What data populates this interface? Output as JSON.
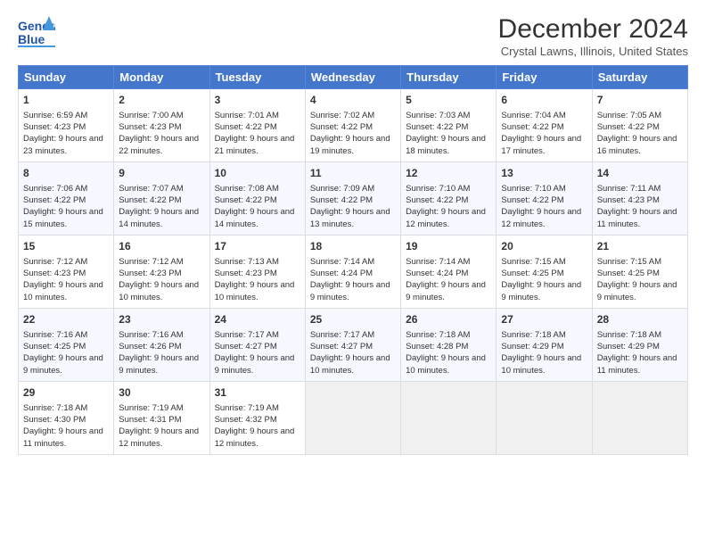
{
  "header": {
    "logo_line1": "General",
    "logo_line2": "Blue",
    "month_title": "December 2024",
    "location": "Crystal Lawns, Illinois, United States"
  },
  "days_of_week": [
    "Sunday",
    "Monday",
    "Tuesday",
    "Wednesday",
    "Thursday",
    "Friday",
    "Saturday"
  ],
  "weeks": [
    [
      {
        "day": "1",
        "sunrise": "6:59 AM",
        "sunset": "4:23 PM",
        "daylight": "9 hours and 23 minutes."
      },
      {
        "day": "2",
        "sunrise": "7:00 AM",
        "sunset": "4:23 PM",
        "daylight": "9 hours and 22 minutes."
      },
      {
        "day": "3",
        "sunrise": "7:01 AM",
        "sunset": "4:22 PM",
        "daylight": "9 hours and 21 minutes."
      },
      {
        "day": "4",
        "sunrise": "7:02 AM",
        "sunset": "4:22 PM",
        "daylight": "9 hours and 19 minutes."
      },
      {
        "day": "5",
        "sunrise": "7:03 AM",
        "sunset": "4:22 PM",
        "daylight": "9 hours and 18 minutes."
      },
      {
        "day": "6",
        "sunrise": "7:04 AM",
        "sunset": "4:22 PM",
        "daylight": "9 hours and 17 minutes."
      },
      {
        "day": "7",
        "sunrise": "7:05 AM",
        "sunset": "4:22 PM",
        "daylight": "9 hours and 16 minutes."
      }
    ],
    [
      {
        "day": "8",
        "sunrise": "7:06 AM",
        "sunset": "4:22 PM",
        "daylight": "9 hours and 15 minutes."
      },
      {
        "day": "9",
        "sunrise": "7:07 AM",
        "sunset": "4:22 PM",
        "daylight": "9 hours and 14 minutes."
      },
      {
        "day": "10",
        "sunrise": "7:08 AM",
        "sunset": "4:22 PM",
        "daylight": "9 hours and 14 minutes."
      },
      {
        "day": "11",
        "sunrise": "7:09 AM",
        "sunset": "4:22 PM",
        "daylight": "9 hours and 13 minutes."
      },
      {
        "day": "12",
        "sunrise": "7:10 AM",
        "sunset": "4:22 PM",
        "daylight": "9 hours and 12 minutes."
      },
      {
        "day": "13",
        "sunrise": "7:10 AM",
        "sunset": "4:22 PM",
        "daylight": "9 hours and 12 minutes."
      },
      {
        "day": "14",
        "sunrise": "7:11 AM",
        "sunset": "4:23 PM",
        "daylight": "9 hours and 11 minutes."
      }
    ],
    [
      {
        "day": "15",
        "sunrise": "7:12 AM",
        "sunset": "4:23 PM",
        "daylight": "9 hours and 10 minutes."
      },
      {
        "day": "16",
        "sunrise": "7:12 AM",
        "sunset": "4:23 PM",
        "daylight": "9 hours and 10 minutes."
      },
      {
        "day": "17",
        "sunrise": "7:13 AM",
        "sunset": "4:23 PM",
        "daylight": "9 hours and 10 minutes."
      },
      {
        "day": "18",
        "sunrise": "7:14 AM",
        "sunset": "4:24 PM",
        "daylight": "9 hours and 9 minutes."
      },
      {
        "day": "19",
        "sunrise": "7:14 AM",
        "sunset": "4:24 PM",
        "daylight": "9 hours and 9 minutes."
      },
      {
        "day": "20",
        "sunrise": "7:15 AM",
        "sunset": "4:25 PM",
        "daylight": "9 hours and 9 minutes."
      },
      {
        "day": "21",
        "sunrise": "7:15 AM",
        "sunset": "4:25 PM",
        "daylight": "9 hours and 9 minutes."
      }
    ],
    [
      {
        "day": "22",
        "sunrise": "7:16 AM",
        "sunset": "4:25 PM",
        "daylight": "9 hours and 9 minutes."
      },
      {
        "day": "23",
        "sunrise": "7:16 AM",
        "sunset": "4:26 PM",
        "daylight": "9 hours and 9 minutes."
      },
      {
        "day": "24",
        "sunrise": "7:17 AM",
        "sunset": "4:27 PM",
        "daylight": "9 hours and 9 minutes."
      },
      {
        "day": "25",
        "sunrise": "7:17 AM",
        "sunset": "4:27 PM",
        "daylight": "9 hours and 10 minutes."
      },
      {
        "day": "26",
        "sunrise": "7:18 AM",
        "sunset": "4:28 PM",
        "daylight": "9 hours and 10 minutes."
      },
      {
        "day": "27",
        "sunrise": "7:18 AM",
        "sunset": "4:29 PM",
        "daylight": "9 hours and 10 minutes."
      },
      {
        "day": "28",
        "sunrise": "7:18 AM",
        "sunset": "4:29 PM",
        "daylight": "9 hours and 11 minutes."
      }
    ],
    [
      {
        "day": "29",
        "sunrise": "7:18 AM",
        "sunset": "4:30 PM",
        "daylight": "9 hours and 11 minutes."
      },
      {
        "day": "30",
        "sunrise": "7:19 AM",
        "sunset": "4:31 PM",
        "daylight": "9 hours and 12 minutes."
      },
      {
        "day": "31",
        "sunrise": "7:19 AM",
        "sunset": "4:32 PM",
        "daylight": "9 hours and 12 minutes."
      },
      null,
      null,
      null,
      null
    ]
  ],
  "labels": {
    "sunrise": "Sunrise:",
    "sunset": "Sunset:",
    "daylight": "Daylight:"
  }
}
